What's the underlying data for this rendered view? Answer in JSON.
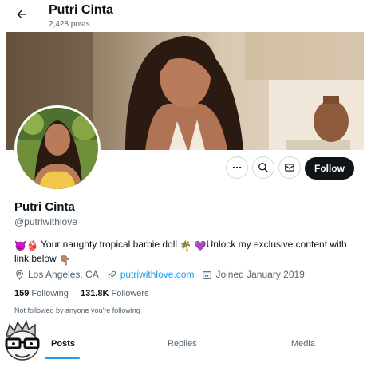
{
  "header": {
    "name": "Putri Cinta",
    "posts": "2,428 posts"
  },
  "profile": {
    "name": "Putri Cinta",
    "handle": "@putriwithlove",
    "bio": {
      "emoji1": "😈",
      "emoji2": "👙",
      "text1": "Your naughty tropical barbie doll",
      "emoji3": "🌴",
      "emoji4": "💜",
      "text2": "Unlock my exclusive content with link below",
      "emoji5": "👇🏽"
    },
    "location": "Los Angeles, CA",
    "website": "putriwithlove.com",
    "joined": "Joined January 2019",
    "following_count": "159",
    "following_label": "Following",
    "followers_count": "131.8K",
    "followers_label": "Followers",
    "not_followed": "Not followed by anyone you're following"
  },
  "actions": {
    "follow": "Follow"
  },
  "tabs": [
    {
      "label": "Posts"
    },
    {
      "label": "Replies"
    },
    {
      "label": "Media"
    }
  ],
  "colors": {
    "accent": "#1d9bf0",
    "follow_bg": "#0f1419",
    "secondary_text": "#536471"
  }
}
